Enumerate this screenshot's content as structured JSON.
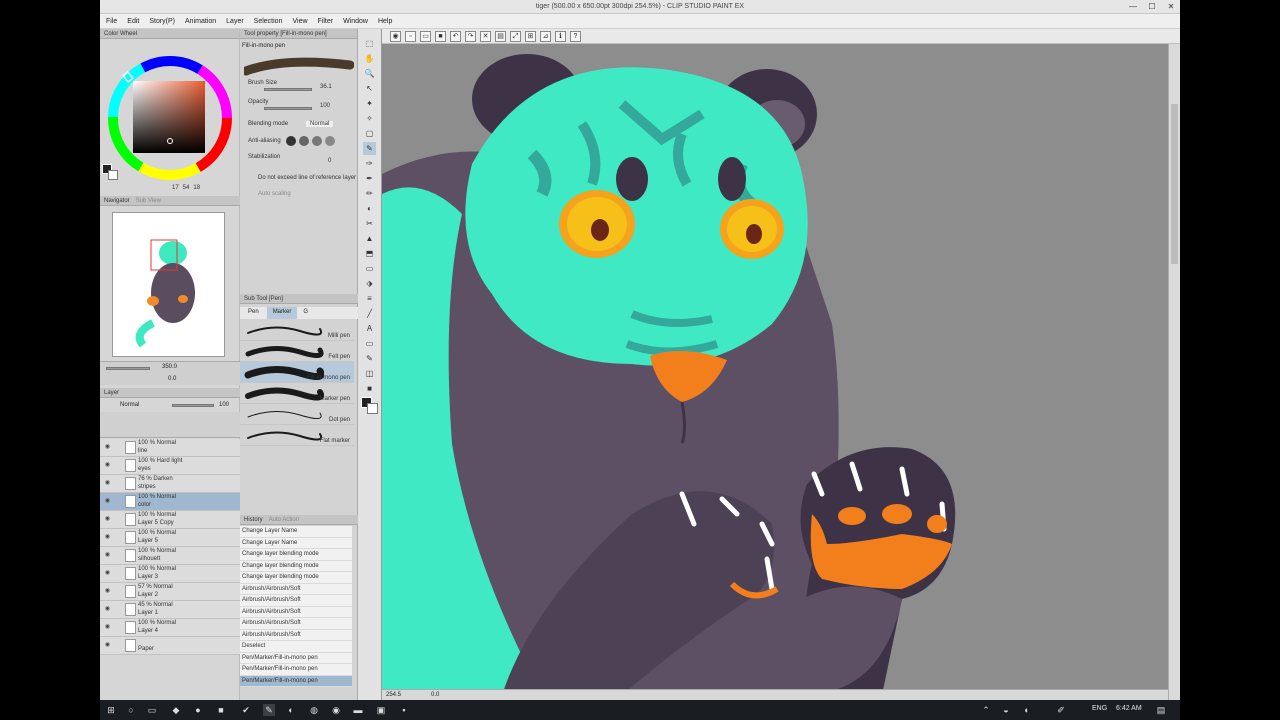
{
  "window": {
    "title": "tiger (500.00 x 650.00pt 300dpi 254.5%) - CLIP STUDIO PAINT EX",
    "minimize": "—",
    "maximize": "☐",
    "close": "✕"
  },
  "menu": [
    "File",
    "Edit",
    "Story(P)",
    "Animation",
    "Layer",
    "Selection",
    "View",
    "Filter",
    "Window",
    "Help"
  ],
  "color_wheel": {
    "tab": "Color Wheel",
    "h": "17",
    "s": "54",
    "v": "18",
    "main_color": "#222222"
  },
  "navigator": {
    "tabs": [
      "Navigator",
      "Sub View"
    ],
    "zoom": "350.0",
    "angle": "0.0"
  },
  "tool_property": {
    "tab": "Tool property [Fill-in-mono pen]",
    "brush_name": "Fill-in-mono pen",
    "brush_size_label": "Brush Size",
    "brush_size_value": "36.1",
    "opacity_label": "Opacity",
    "opacity_value": "100",
    "blending_label": "Blending mode",
    "blending_value": "Normal",
    "antialias_label": "Anti-aliasing",
    "stabilization_label": "Stabilization",
    "stabilization_value": "0",
    "ref_layer_label": "Do not exceed line of reference layer",
    "auto_scaling_label": "Auto scaling"
  },
  "sub_tool": {
    "tab": "Sub Tool [Pen]",
    "tabs": [
      "Pen",
      "Marker",
      "G"
    ],
    "brushes": [
      "Milli pen",
      "Felt pen",
      "Fill-in-mono pen",
      "Marker pen",
      "Dot pen",
      "Flat marker"
    ]
  },
  "layer_panel": {
    "tab": "Layer",
    "blend": "Normal",
    "opacity": "100",
    "layers": [
      {
        "l1": "100 % Normal",
        "l2": "line"
      },
      {
        "l1": "100 % Hard light",
        "l2": "eyes"
      },
      {
        "l1": "76 % Darken",
        "l2": "stripes"
      },
      {
        "l1": "100 % Normal",
        "l2": "color"
      },
      {
        "l1": "100 % Normal",
        "l2": "Layer 5 Copy"
      },
      {
        "l1": "100 % Normal",
        "l2": "Layer 5"
      },
      {
        "l1": "100 % Normal",
        "l2": "silhouett"
      },
      {
        "l1": "100 % Normal",
        "l2": "Layer 3"
      },
      {
        "l1": "57 % Normal",
        "l2": "Layer 2"
      },
      {
        "l1": "45 % Normal",
        "l2": "Layer 1"
      },
      {
        "l1": "100 % Normal",
        "l2": "Layer 4"
      },
      {
        "l1": "",
        "l2": "Paper"
      }
    ]
  },
  "history": {
    "tabs": [
      "History",
      "Auto Action"
    ],
    "items": [
      "Change Layer Name",
      "Change Layer Name",
      "Change layer blending mode",
      "Change layer blending mode",
      "Change layer blending mode",
      "Airbrush/Airbrush/Soft",
      "Airbrush/Airbrush/Soft",
      "Airbrush/Airbrush/Soft",
      "Airbrush/Airbrush/Soft",
      "Airbrush/Airbrush/Soft",
      "Deselect",
      "Pen/Marker/Fill-in-mono pen",
      "Pen/Marker/Fill-in-mono pen",
      "Pen/Marker/Fill-in-mono pen"
    ]
  },
  "canvas": {
    "zoom_status": "254.5",
    "angle_status": "0.0"
  },
  "taskbar": {
    "lang": "ENG",
    "time": "6:42 AM"
  }
}
